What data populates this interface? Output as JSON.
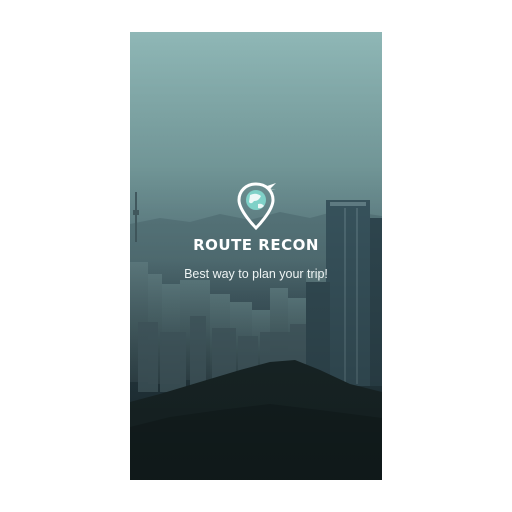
{
  "splash": {
    "app_name": "ROUTE RECON",
    "tagline": "Best way to plan your trip!",
    "logo_icon": "map-pin-globe-icon"
  },
  "colors": {
    "sky_top": "#8fb7b6",
    "mountain": "#1e2e2f",
    "text": "#ffffff",
    "logo_accent": "#7fd1c8"
  }
}
